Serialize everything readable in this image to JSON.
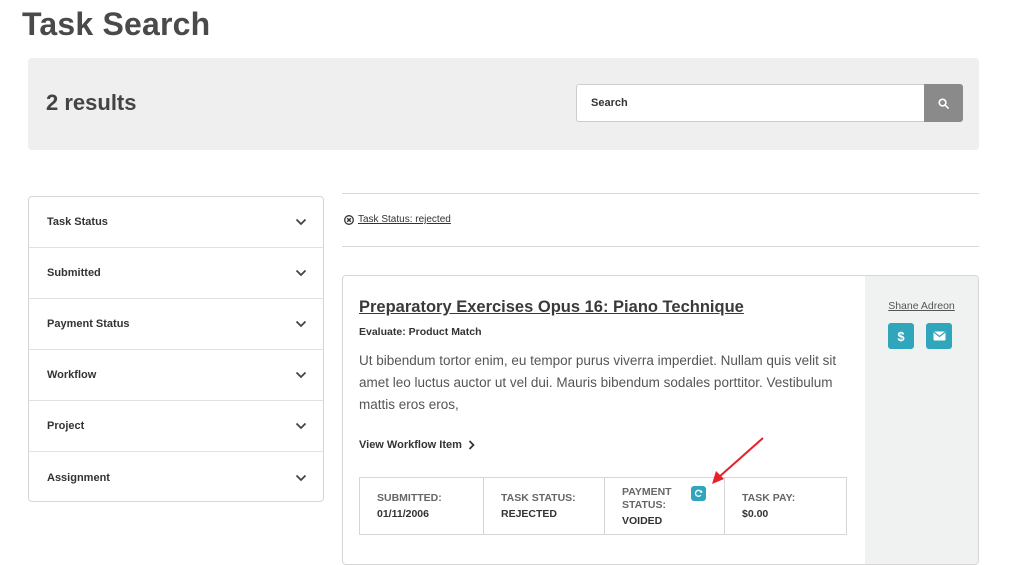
{
  "page": {
    "title": "Task Search"
  },
  "results": {
    "count_label": "2 results"
  },
  "search": {
    "placeholder": "Search"
  },
  "filters": [
    {
      "label": "Task Status"
    },
    {
      "label": "Submitted"
    },
    {
      "label": "Payment Status"
    },
    {
      "label": "Workflow"
    },
    {
      "label": "Project"
    },
    {
      "label": "Assignment"
    }
  ],
  "active_filter": {
    "label": "Task Status: rejected"
  },
  "task": {
    "title": "Preparatory Exercises Opus 16: Piano Technique",
    "subtitle": "Evaluate: Product Match",
    "description": "Ut bibendum tortor enim, eu tempor purus viverra imperdiet. Nullam quis velit sit amet leo luctus auctor ut vel dui. Mauris bibendum sodales porttitor. Vestibulum mattis eros eros,",
    "workflow_link": "View Workflow Item",
    "assignee": "Shane Adreon",
    "submitted_label": "SUBMITTED:",
    "submitted_value": "01/11/2006",
    "task_status_label": "TASK STATUS:",
    "task_status_value": "REJECTED",
    "payment_status_label": "PAYMENT STATUS:",
    "payment_status_value": "VOIDED",
    "task_pay_label": "TASK PAY:",
    "task_pay_value": "$0.00"
  },
  "colors": {
    "accent": "#2fa6bb",
    "annotation_arrow": "#e8202a"
  },
  "icons": [
    "search-icon",
    "chevron-down-icon",
    "close-circle-icon",
    "chevron-right-icon",
    "dollar-icon",
    "envelope-icon",
    "refresh-icon"
  ]
}
